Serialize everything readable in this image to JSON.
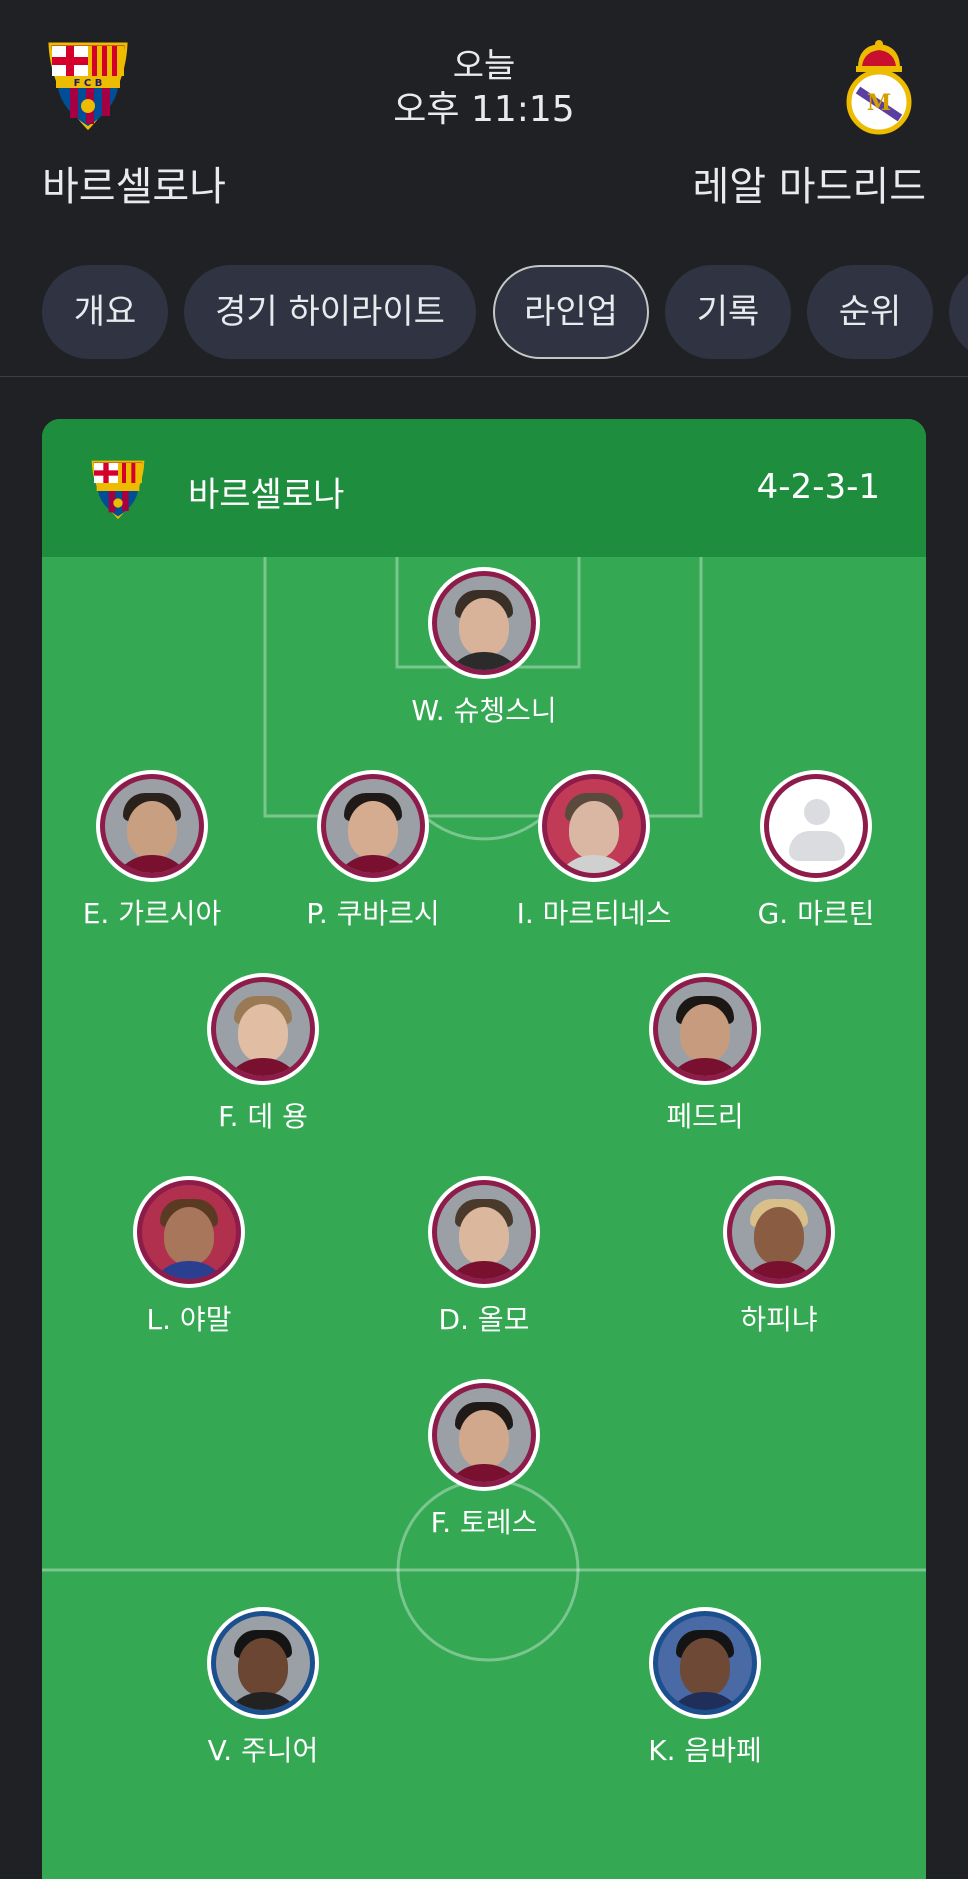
{
  "match": {
    "day": "오늘",
    "time": "오후 11:15",
    "home_team": "바르셀로나",
    "away_team": "레알 마드리드",
    "home_crest": "fc-barcelona-crest",
    "away_crest": "real-madrid-crest"
  },
  "tabs": [
    {
      "label": "개요",
      "active": false
    },
    {
      "label": "경기 하이라이트",
      "active": false
    },
    {
      "label": "라인업",
      "active": true
    },
    {
      "label": "기록",
      "active": false
    },
    {
      "label": "순위",
      "active": false
    }
  ],
  "lineup": {
    "team": "바르셀로나",
    "formation": "4-2-3-1",
    "home_players": [
      {
        "name": "W. 슈쳉스니"
      },
      {
        "name": "E. 가르시아"
      },
      {
        "name": "P. 쿠바르시"
      },
      {
        "name": "I. 마르티네스"
      },
      {
        "name": "G. 마르틴"
      },
      {
        "name": "F. 데 용"
      },
      {
        "name": "페드리"
      },
      {
        "name": "L. 야말"
      },
      {
        "name": "D. 올모"
      },
      {
        "name": "하피냐"
      },
      {
        "name": "F. 토레스"
      }
    ],
    "away_players": [
      {
        "name": "V. 주니어"
      },
      {
        "name": "K. 음바페"
      }
    ]
  },
  "colors": {
    "background": "#202124",
    "tab_bg": "#303442",
    "card_header": "#1e8e3e",
    "pitch": "#34a853",
    "home_ring": "#8e1c4a",
    "away_ring": "#1c4f8e"
  }
}
